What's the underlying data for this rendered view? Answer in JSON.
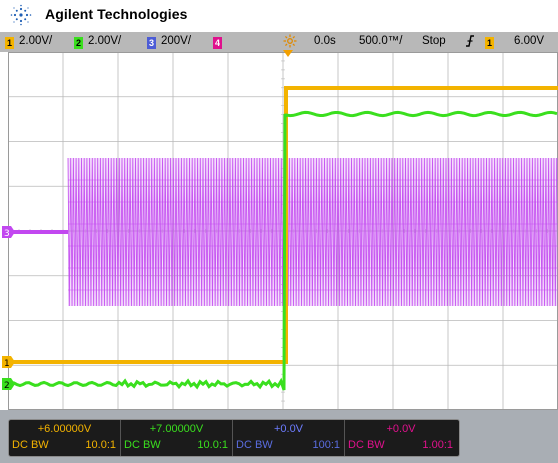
{
  "brand": {
    "name": "Agilent Technologies",
    "logo_icon": "agilent-spark-icon"
  },
  "status": {
    "ch1": {
      "number": "1",
      "scale": "2.00V/",
      "color": "#f3b300"
    },
    "ch2": {
      "number": "2",
      "scale": "2.00V/",
      "color": "#3adf1e"
    },
    "ch3": {
      "number": "3",
      "scale": "200V/",
      "color": "#4c5cd6"
    },
    "ch4": {
      "number": "4",
      "color": "#e0118d"
    },
    "trigger_icon": "trigger-position-icon",
    "time_delay": "0.0s",
    "time_base": "500.0™/",
    "run_state": "Stop",
    "trigger_edge_icon": "rising-edge-icon",
    "trigger_source": "1",
    "trigger_level": "6.00V"
  },
  "markers": {
    "ch1": "1",
    "ch2": "2",
    "ch3": "3"
  },
  "channels": [
    {
      "value": "+6.00000V",
      "coupling": "DC BW",
      "probe": "10.0:1",
      "color": "#f3b300",
      "value_color": "#f3b300"
    },
    {
      "value": "+7.00000V",
      "coupling": "DC BW",
      "probe": "10.0:1",
      "color": "#3adf1e",
      "value_color": "#3adf1e"
    },
    {
      "value": "+0.0V",
      "coupling": "DC BW",
      "probe": "100:1",
      "color": "#5a6de0",
      "value_color": "#6d7cff"
    },
    {
      "value": "+0.0V",
      "coupling": "DC BW",
      "probe": "1.00:1",
      "color": "#e0118d",
      "value_color": "#e0118d"
    }
  ],
  "colors": {
    "ch1": "#f3b300",
    "ch2": "#3adf1e",
    "ch3": "#c248f0",
    "ch4": "#e0118d",
    "grid": "#b9b9b9",
    "trigger_marker": "#f3a000"
  }
}
